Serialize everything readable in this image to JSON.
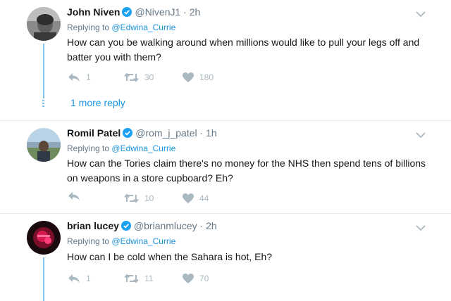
{
  "colors": {
    "link": "#1b95e0",
    "muted": "#657786",
    "thread": "#7fc6ec",
    "verified": "#1da1f2",
    "icon": "#aab8c2"
  },
  "tweets": [
    {
      "name": "John Niven",
      "handle": "@NivenJ1",
      "separator": "·",
      "time": "2h",
      "replying_prefix": "Replying to",
      "replying_handle": "@Edwina_Currie",
      "text": "How can you be walking around when millions would like to pull your legs off and batter you with them?",
      "reply_count": "1",
      "retweet_count": "30",
      "like_count": "180",
      "more_replies": "1 more reply"
    },
    {
      "name": "Romil Patel",
      "handle": "@rom_j_patel",
      "separator": "·",
      "time": "1h",
      "replying_prefix": "Replying to",
      "replying_handle": "@Edwina_Currie",
      "text": "How can the Tories claim there's no money for the NHS then spend tens of billions on weapons in a store cupboard? Eh?",
      "reply_count": "",
      "retweet_count": "10",
      "like_count": "44"
    },
    {
      "name": "brian lucey",
      "handle": "@brianmlucey",
      "separator": "·",
      "time": "2h",
      "replying_prefix": "Replying to",
      "replying_handle": "@Edwina_Currie",
      "text": "How can I be cold when the Sahara is hot, Eh?",
      "reply_count": "1",
      "retweet_count": "11",
      "like_count": "70"
    }
  ]
}
